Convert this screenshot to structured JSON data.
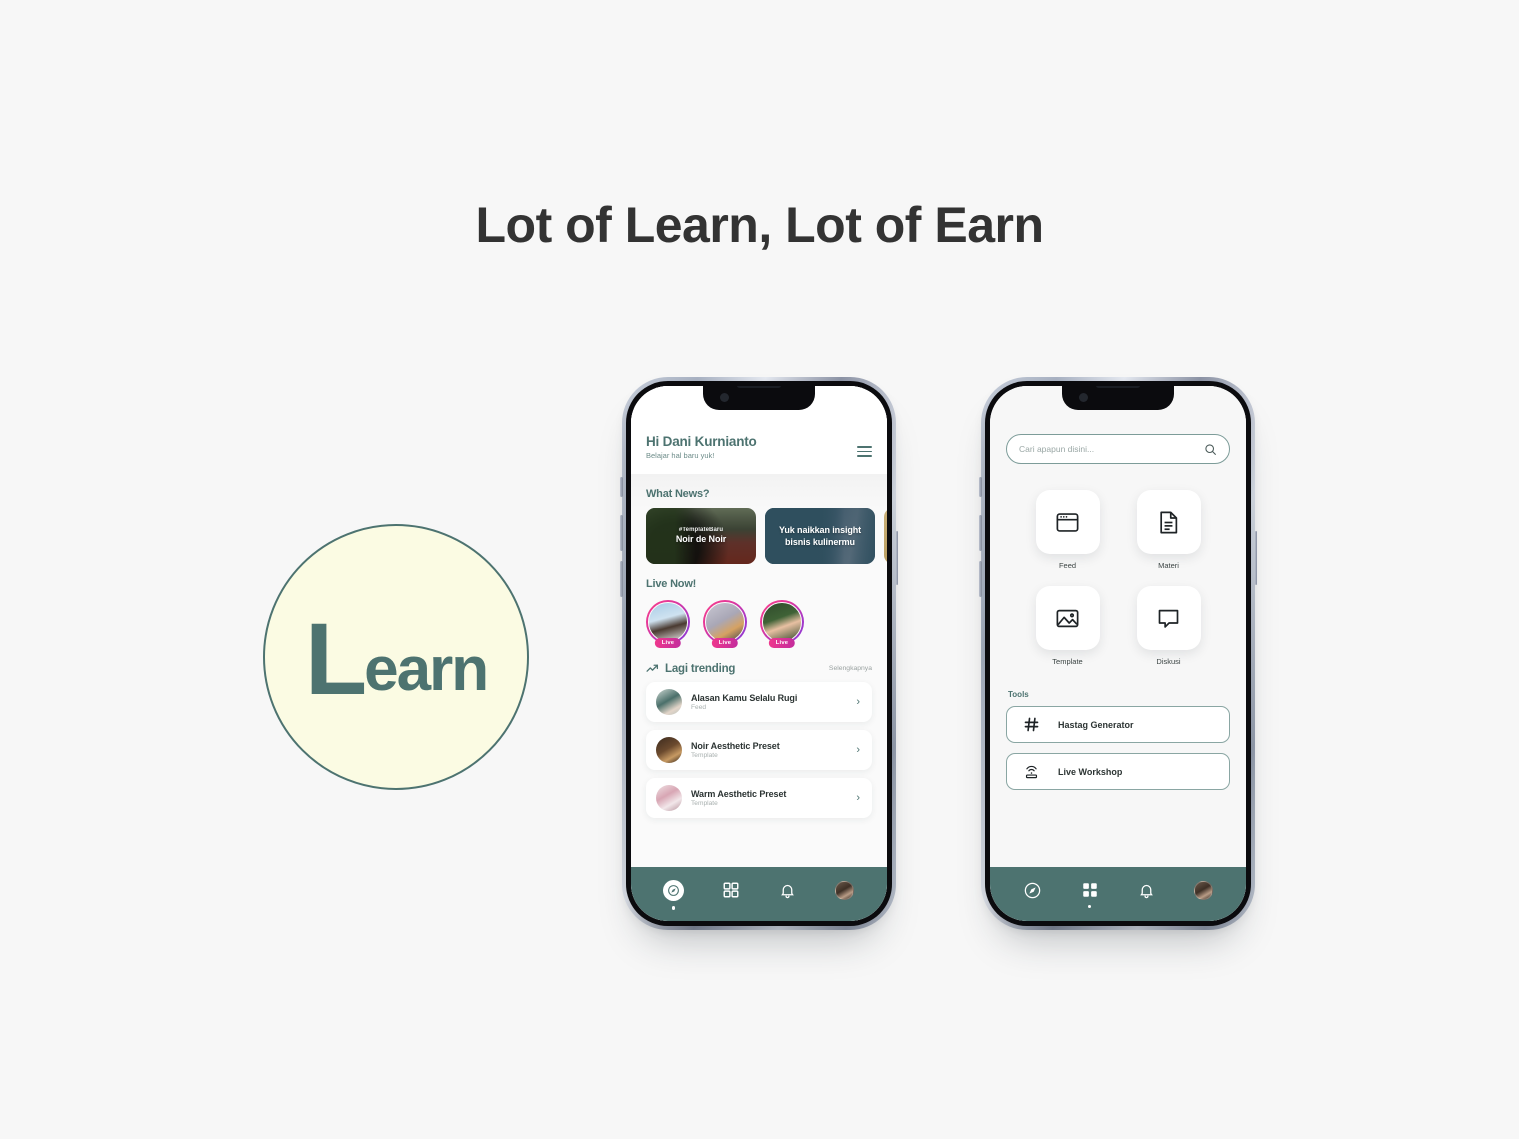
{
  "headline": "Lot of Learn, Lot of Earn",
  "logo": {
    "big_letter": "L",
    "rest": "earn",
    "fill_color": "#fbfbe3",
    "border_color": "#4d7370",
    "text_color": "#4d7370"
  },
  "theme": {
    "accent": "#4d7370",
    "page_bg": "#f7f7f7",
    "card_dark": "#2f4f5e",
    "live_gradient_start": "#f9408a",
    "live_gradient_end": "#8b3ad1"
  },
  "phone1": {
    "header": {
      "greeting": "Hi Dani Kurnianto",
      "subtitle": "Belajar hal baru yuk!",
      "menu_icon": "hamburger-icon"
    },
    "news": {
      "section_title": "What News?",
      "cards": [
        {
          "tag": "#TemplateBaru",
          "title": "Noir de Noir",
          "style": "photo"
        },
        {
          "tag": "",
          "title": "Yuk naikkan insight bisnis kulinermu",
          "style": "teal"
        },
        {
          "tag": "",
          "title": "",
          "style": "gold"
        }
      ]
    },
    "live": {
      "section_title": "Live Now!",
      "badge_label": "Live",
      "items": [
        {
          "avatar": "avatar-1",
          "badge": "Live"
        },
        {
          "avatar": "avatar-2",
          "badge": "Live"
        },
        {
          "avatar": "avatar-3",
          "badge": "Live"
        }
      ]
    },
    "trending": {
      "title": "Lagi trending",
      "more_label": "Selengkapnya",
      "icon": "trending-up-icon",
      "items": [
        {
          "name": "Alasan Kamu Selalu Rugi",
          "type": "Feed"
        },
        {
          "name": "Noir Aesthetic Preset",
          "type": "Template"
        },
        {
          "name": "Warm Aesthetic Preset",
          "type": "Template"
        }
      ]
    },
    "nav": {
      "items": [
        {
          "icon": "compass-icon",
          "active": true
        },
        {
          "icon": "grid-icon",
          "active": false
        },
        {
          "icon": "bell-icon",
          "active": false
        },
        {
          "icon": "avatar-icon",
          "active": false
        }
      ]
    }
  },
  "phone2": {
    "search": {
      "placeholder": "Cari apapun disini...",
      "icon": "search-icon"
    },
    "apps": [
      {
        "label": "Feed",
        "icon": "browser-window-icon"
      },
      {
        "label": "Materi",
        "icon": "document-icon"
      },
      {
        "label": "Template",
        "icon": "image-icon"
      },
      {
        "label": "Diskusi",
        "icon": "chat-bubble-icon"
      }
    ],
    "tools": {
      "title": "Tools",
      "items": [
        {
          "label": "Hastag Generator",
          "icon": "hash-icon"
        },
        {
          "label": "Live Workshop",
          "icon": "broadcast-icon"
        }
      ]
    },
    "nav": {
      "items": [
        {
          "icon": "compass-icon",
          "active": false
        },
        {
          "icon": "grid-icon",
          "active": true
        },
        {
          "icon": "bell-icon",
          "active": false
        },
        {
          "icon": "avatar-icon",
          "active": false
        }
      ]
    }
  }
}
